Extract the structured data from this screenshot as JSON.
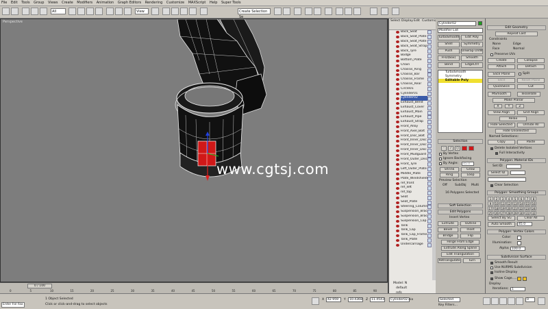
{
  "menu": [
    "File",
    "Edit",
    "Tools",
    "Group",
    "Views",
    "Create",
    "Modifiers",
    "Animation",
    "Graph Editors",
    "Rendering",
    "Customize",
    "MAXScript",
    "Help",
    "Super Tools"
  ],
  "toolbar": {
    "selection_filter": "All",
    "create_selection_set": "Create Selection Se",
    "view_dropdown": "View"
  },
  "viewport": {
    "label": "Perspective",
    "watermark": "www.cgtsj.com"
  },
  "scene_explorer": {
    "tabs": [
      "Select",
      "Display",
      "Edit",
      "Customize"
    ],
    "items": [
      "Back_Seat",
      "Back_Seat_Plate",
      "Back_Seat_Plate",
      "Back_Seat_Strap",
      "Back_Tyre",
      "Bodge",
      "Bottom_Plate",
      "Chain",
      "Chassis_Ring",
      "Chassis_Bar",
      "Chassis_Frame",
      "Chassis_Rear",
      "Circle01",
      "Cylinder01",
      "Cylinder02",
      "Exhaust_Bend",
      "Exhaust_Cover",
      "Exhaust_Main",
      "Exhaust_Pipe",
      "Exhaust_Strap",
      "Front_Alloy",
      "Front_Axel_Bolt",
      "Front_Disc_Bolt",
      "Front_Inner_Disc",
      "Front_Inner_Disc",
      "Front_Inner_Disc",
      "Front_Mudguard",
      "Front_Outer_Disc",
      "Front_Tyre",
      "Left_Outer_Plate",
      "Middle_Plate",
      "Plate_Windshield",
      "ref_front",
      "ref_left",
      "ref_top",
      "Seat",
      "Seat_Plate",
      "Steering_Column",
      "Suspension_Bracket",
      "Suspension_Bracket",
      "Suspension_Cap",
      "Tank",
      "Tank_Cap",
      "Tank_Cap_Frame",
      "Tank_Plate",
      "Undercarriage"
    ],
    "selected_index": 14,
    "footer": [
      "Model: N",
      "default",
      "refs"
    ]
  },
  "modify": {
    "object_name": "Cylinder02",
    "modifier_list": "Modifier List",
    "buttons": [
      "TurboSmooth",
      "Edit Poly",
      "Shell",
      "Symmetry",
      "Push",
      "Unwrap UVW",
      "FFD(box)",
      "Smooth",
      "Bend",
      "EdgeCtrl"
    ],
    "stack": [
      "TurboSmooth",
      "Symmetry",
      "Editable Poly"
    ],
    "selection_header": "Selection",
    "by_vertex": "By Vertex",
    "ignore_backfacing": "Ignore Backfacing",
    "by_angle": "By Angle:",
    "angle_value": "45.0",
    "shrink": "Shrink",
    "grow": "Grow",
    "ring": "Ring",
    "loop": "Loop",
    "preview_selection": "Preview Selection",
    "preview_opts": [
      "Off",
      "SubObj",
      "Multi"
    ],
    "polys_selected": "16 Polygons Selected",
    "soft_selection": "Soft Selection",
    "edit_polygons": "Edit Polygons",
    "insert_vertex": "Insert Vertex",
    "ep_buttons": [
      "Extrude",
      "Outline",
      "Bevel",
      "Inset",
      "Bridge",
      "Flip"
    ],
    "hinge": "Hinge From Edge",
    "extrude_spline": "Extrude Along Spline",
    "edit_tri": "Edit Triangulation",
    "retriangulate": "Retriangulate",
    "turn": "Turn"
  },
  "command": {
    "edit_geometry": "Edit Geometry",
    "repeat_last": "Repeat Last",
    "constraints": "Constraints",
    "constraint_opts": [
      "None",
      "Edge",
      "Face",
      "Normal"
    ],
    "preserve_uvs": "Preserve UVs",
    "create": "Create",
    "collapse": "Collapse",
    "attach": "Attach",
    "detach": "Detach",
    "slice_plane": "Slice Plane",
    "split": "Split",
    "slice": "Slice",
    "reset_plane": "Reset Plane",
    "quickslice": "QuickSlice",
    "cut": "Cut",
    "msmooth": "MSmooth",
    "tessellate": "Tessellate",
    "make_planar": "Make Planar",
    "xyz": [
      "X",
      "Y",
      "Z"
    ],
    "view_align": "View Align",
    "grid_align": "Grid Align",
    "relax": "Relax",
    "hide_selected": "Hide Selected",
    "unhide_all": "Unhide All",
    "hide_unselected": "Hide Unselected",
    "named_selections": "Named Selections:",
    "copy": "Copy",
    "paste": "Paste",
    "delete_isolated": "Delete Isolated Vertices",
    "full_interactivity": "Full Interactivity",
    "poly_material": "Polygon: Material IDs",
    "set_id": "Set ID:",
    "select_id": "Select ID",
    "clear_selection": "Clear Selection",
    "smoothing_groups": "Polygon: Smoothing Groups",
    "sg_numbers": [
      "1",
      "2",
      "3",
      "4",
      "5",
      "6",
      "7",
      "8",
      "9",
      "10",
      "11",
      "12",
      "13",
      "14",
      "15",
      "16",
      "17",
      "18",
      "19",
      "20",
      "21",
      "22",
      "23",
      "24",
      "25",
      "26",
      "27",
      "28",
      "29",
      "30",
      "31",
      "32"
    ],
    "select_by_sg": "Select By SG",
    "clear_all": "Clear All",
    "auto_smooth": "Auto Smooth",
    "auto_smooth_value": "45.0",
    "vertex_colors": "Polygon: Vertex Colors",
    "color": "Color:",
    "illumination": "Illumination:",
    "alpha": "Alpha:",
    "alpha_value": "100.0",
    "subdivision_surface": "Subdivision Surface",
    "smooth_result": "Smooth Result",
    "use_nurms": "Use NURMS Subdivision",
    "isoline_display": "Isoline Display",
    "show_cage": "Show Cage......",
    "display": "Display",
    "iterations": "Iterations:",
    "iterations_value": "1"
  },
  "timeline": {
    "frame": "0 / 100",
    "ticks": [
      "0",
      "5",
      "10",
      "15",
      "20",
      "25",
      "30",
      "35",
      "40",
      "45",
      "50",
      "55",
      "60",
      "65",
      "70",
      "75",
      "80",
      "85",
      "90"
    ]
  },
  "status": {
    "objects_selected": "1 Object Selected",
    "prompt": "Click or click-and-drag to select objects",
    "x_value": "42.959",
    "y_value": "10.4368",
    "z_value": "11.4543",
    "bottom_left": "Enter Fol  Fax",
    "object_field": "Cylinder02.nix",
    "key_filters": "Key Filters...",
    "selected": "Selected",
    "frame_field": "0"
  },
  "colors": {
    "accent_yellow": "#f0e030",
    "selected_blue": "#3a5aa8",
    "watermark": "#ffffff",
    "poly_red": "#d01818"
  }
}
